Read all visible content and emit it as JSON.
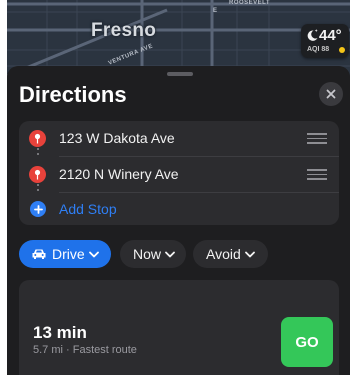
{
  "map": {
    "city": "Fresno",
    "street_labels": [
      "ROOSEVELT",
      "VENTURA AVE",
      "E"
    ]
  },
  "weather": {
    "icon": "moon-stars-icon",
    "temperature": "44°",
    "aqi": "AQI 88",
    "aqi_color": "#f5c518"
  },
  "directions": {
    "title": "Directions",
    "stops": [
      {
        "label": "123 W Dakota Ave",
        "icon": "pin-icon"
      },
      {
        "label": "2120 N Winery Ave",
        "icon": "pin-icon"
      }
    ],
    "add_stop": "Add Stop"
  },
  "options": {
    "mode": "Drive",
    "time": "Now",
    "avoid": "Avoid"
  },
  "route": {
    "duration": "13 min",
    "detail": "5.7 mi · Fastest route",
    "go": "GO"
  },
  "colors": {
    "accent": "#1f72ea",
    "go": "#34c759",
    "pin": "#e8423b"
  }
}
